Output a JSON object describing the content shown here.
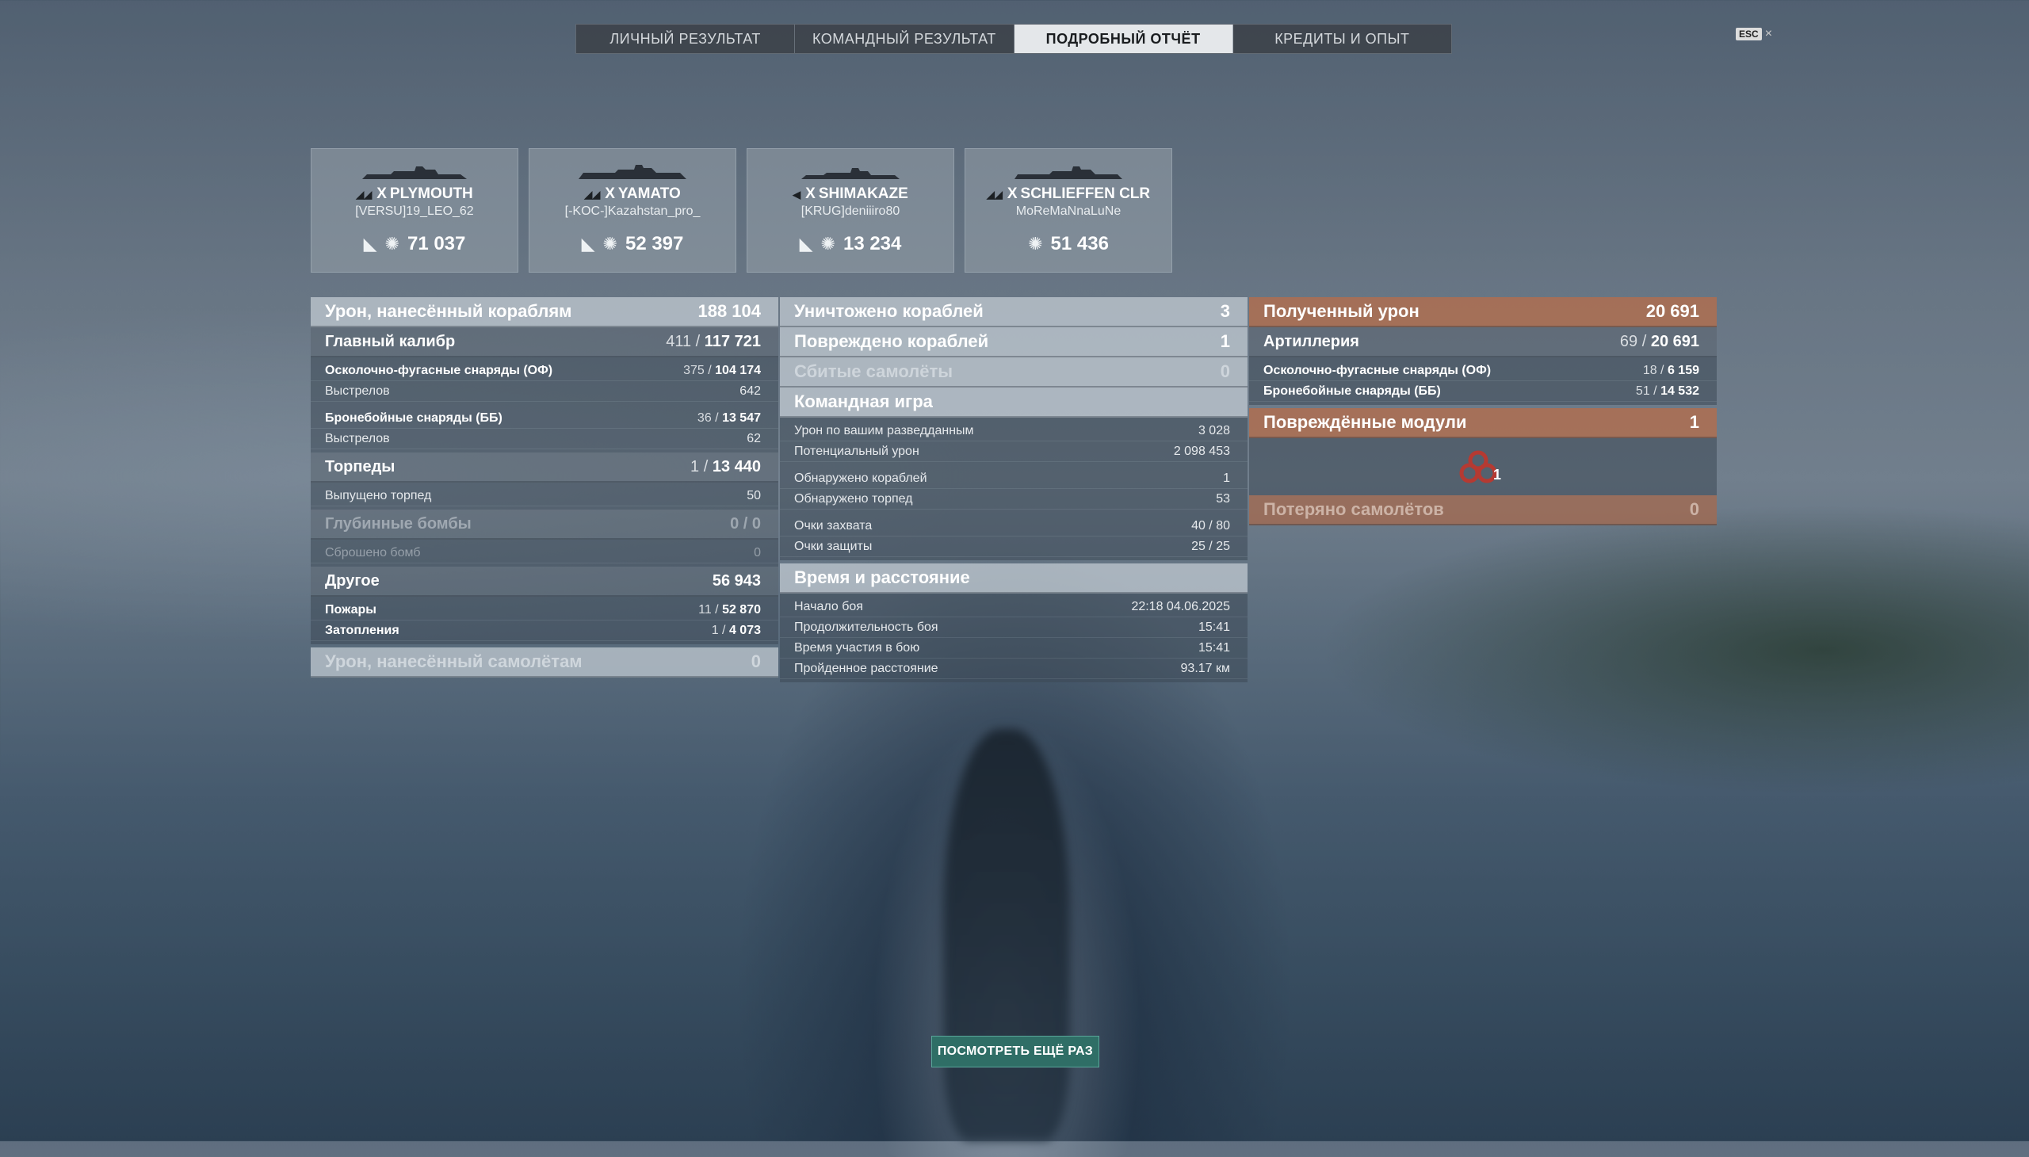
{
  "tabs": [
    "ЛИЧНЫЙ РЕЗУЛЬТАТ",
    "КОМАНДНЫЙ РЕЗУЛЬТАТ",
    "ПОДРОБНЫЙ ОТЧЁТ",
    "КРЕДИТЫ И ОПЫТ"
  ],
  "active_tab": "ПОДРОБНЫЙ ОТЧЁТ",
  "esc": {
    "key": "ESC",
    "close": "×"
  },
  "ships": [
    {
      "tier": "X",
      "name": "PLYMOUTH",
      "player": "[VERSU]19_LEO_62",
      "damage": "71 037"
    },
    {
      "tier": "X",
      "name": "YAMATO",
      "player": "[-KOC-]Kazahstan_pro_",
      "damage": "52 397"
    },
    {
      "tier": "X",
      "name": "SHIMAKAZE",
      "player": "[KRUG]deniiiro80",
      "damage": "13 234"
    },
    {
      "tier": "X",
      "name": "SCHLIEFFEN CLR",
      "player": "MoReMaNnaLuNe",
      "damage": "51 436"
    }
  ],
  "left": {
    "ship_damage": {
      "label": "Урон, нанесённый кораблям",
      "value": "188 104"
    },
    "main_battery": {
      "label": "Главный калибр",
      "hits": "411",
      "damage": "117 721"
    },
    "he": {
      "label": "Осколочно-фугасные снаряды (ОФ)",
      "hits": "375",
      "damage": "104 174",
      "shots_label": "Выстрелов",
      "shots": "642"
    },
    "ap": {
      "label": "Бронебойные снаряды (ББ)",
      "hits": "36",
      "damage": "13 547",
      "shots_label": "Выстрелов",
      "shots": "62"
    },
    "torpedoes": {
      "label": "Торпеды",
      "hits": "1",
      "damage": "13 440",
      "launched_label": "Выпущено торпед",
      "launched": "50"
    },
    "depth": {
      "label": "Глубинные бомбы",
      "value": "0 / 0",
      "dropped_label": "Сброшено бомб",
      "dropped": "0"
    },
    "other": {
      "label": "Другое",
      "value": "56 943"
    },
    "fires": {
      "label": "Пожары",
      "count": "11",
      "damage": "52 870"
    },
    "floods": {
      "label": "Затопления",
      "count": "1",
      "damage": "4 073"
    },
    "plane_damage": {
      "label": "Урон, нанесённый самолётам",
      "value": "0"
    }
  },
  "middle": {
    "destroyed": {
      "label": "Уничтожено кораблей",
      "value": "3"
    },
    "damaged": {
      "label": "Повреждено кораблей",
      "value": "1"
    },
    "planes": {
      "label": "Сбитые самолёты",
      "value": "0"
    },
    "team": {
      "label": "Командная игра",
      "rows": [
        {
          "label": "Урон по вашим разведданным",
          "value": "3 028"
        },
        {
          "label": "Потенциальный урон",
          "value": "2 098 453"
        },
        {
          "label": "Обнаружено кораблей",
          "value": "1"
        },
        {
          "label": "Обнаружено торпед",
          "value": "53"
        },
        {
          "label": "Очки захвата",
          "value": "40 / 80"
        },
        {
          "label": "Очки защиты",
          "value": "25 / 25"
        }
      ]
    },
    "time": {
      "label": "Время и расстояние",
      "rows": [
        {
          "label": "Начало боя",
          "value": "22:18  04.06.2025"
        },
        {
          "label": "Продолжительность боя",
          "value": "15:41"
        },
        {
          "label": "Время участия в бою",
          "value": "15:41"
        },
        {
          "label": "Пройденное расстояние",
          "value": "93.17 км"
        }
      ]
    }
  },
  "right": {
    "received": {
      "label": "Полученный урон",
      "value": "20 691"
    },
    "artillery": {
      "label": "Артиллерия",
      "hits": "69",
      "damage": "20 691"
    },
    "he": {
      "label": "Осколочно-фугасные снаряды (ОФ)",
      "hits": "18",
      "damage": "6 159"
    },
    "ap": {
      "label": "Бронебойные снаряды (ББ)",
      "hits": "51",
      "damage": "14 532"
    },
    "modules": {
      "label": "Повреждённые модули",
      "value": "1",
      "icon_count": "1"
    },
    "planes_lost": {
      "label": "Потеряно самолётов",
      "value": "0"
    }
  },
  "replay_button": "ПОСМОТРЕТЬ ЕЩЁ РАЗ"
}
